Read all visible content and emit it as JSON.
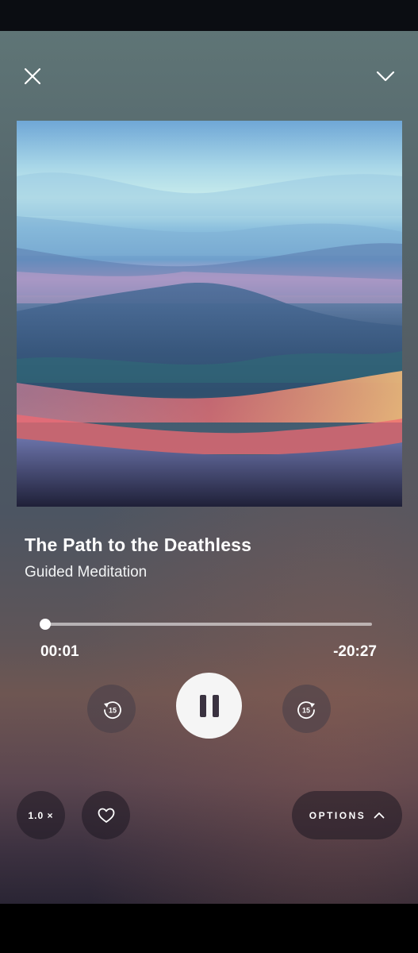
{
  "header": {
    "close_icon": "close-icon",
    "collapse_icon": "chevron-down-icon"
  },
  "artwork": {
    "description_icon": "album-artwork",
    "colors": [
      "#8fc3dd",
      "#c9a6cf",
      "#3f5d86",
      "#2f7a78",
      "#ff8a6e",
      "#f16a75",
      "#3b3b66"
    ]
  },
  "track": {
    "title": "The Path to the Deathless",
    "subtitle": "Guided Meditation"
  },
  "playback": {
    "elapsed": "00:01",
    "remaining": "-20:27",
    "progress_fraction": 0.001,
    "rewind_seconds": "15",
    "forward_seconds": "15",
    "state": "playing",
    "play_icon": "pause-icon"
  },
  "footer": {
    "speed_label": "1.0 ×",
    "favorite_icon": "heart-icon",
    "options_label": "OPTIONS",
    "options_icon": "chevron-up-icon"
  },
  "theme": {
    "accent": "#ffffff",
    "button_bg": "#f5f5f5",
    "icon_dark": "#3a3240"
  }
}
